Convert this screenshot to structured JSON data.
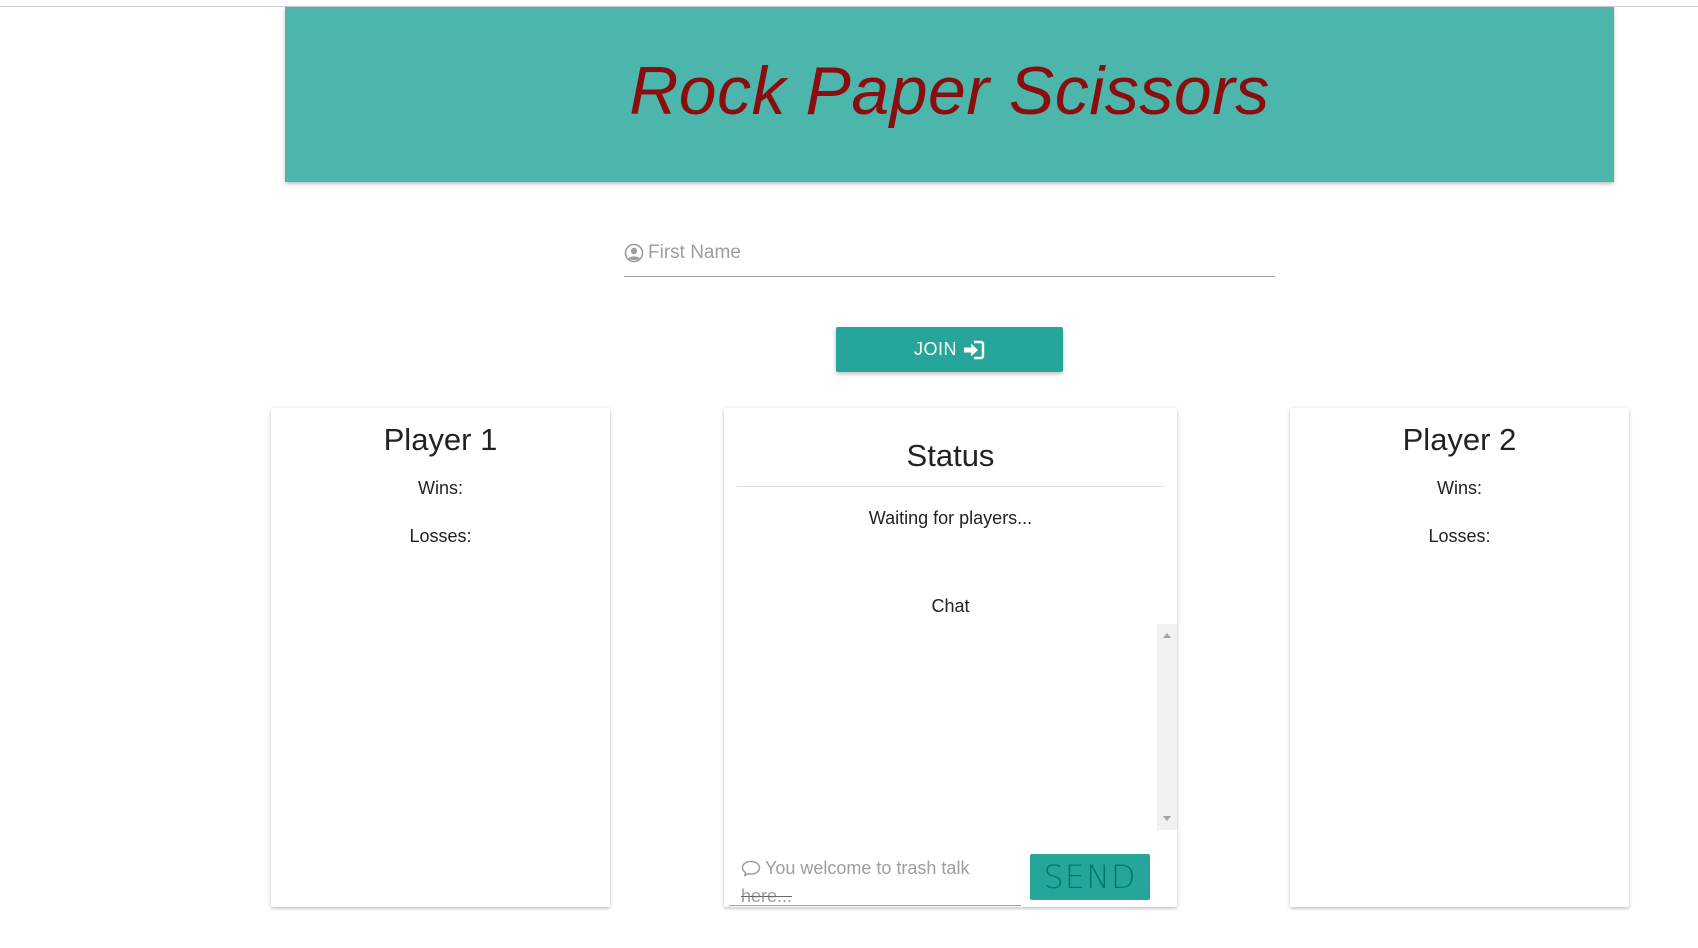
{
  "header": {
    "title": "Rock Paper Scissors",
    "background": "#4db6ac",
    "title_color": "#8b0e0e"
  },
  "join_form": {
    "name_icon": "user-circle-icon",
    "name_placeholder": "First Name",
    "join_label": "JOIN",
    "join_icon": "sign-in-icon",
    "button_color": "#26a69a"
  },
  "player1": {
    "title": "Player 1",
    "wins_label": "Wins:",
    "losses_label": "Losses:"
  },
  "player2": {
    "title": "Player 2",
    "wins_label": "Wins:",
    "losses_label": "Losses:"
  },
  "status": {
    "title": "Status",
    "message": "Waiting for players...",
    "chat_label": "Chat",
    "chat_icon": "comment-icon",
    "chat_placeholder_line1": "You welcome to trash talk",
    "chat_placeholder_line2": "here...",
    "send_label": "SEND"
  }
}
